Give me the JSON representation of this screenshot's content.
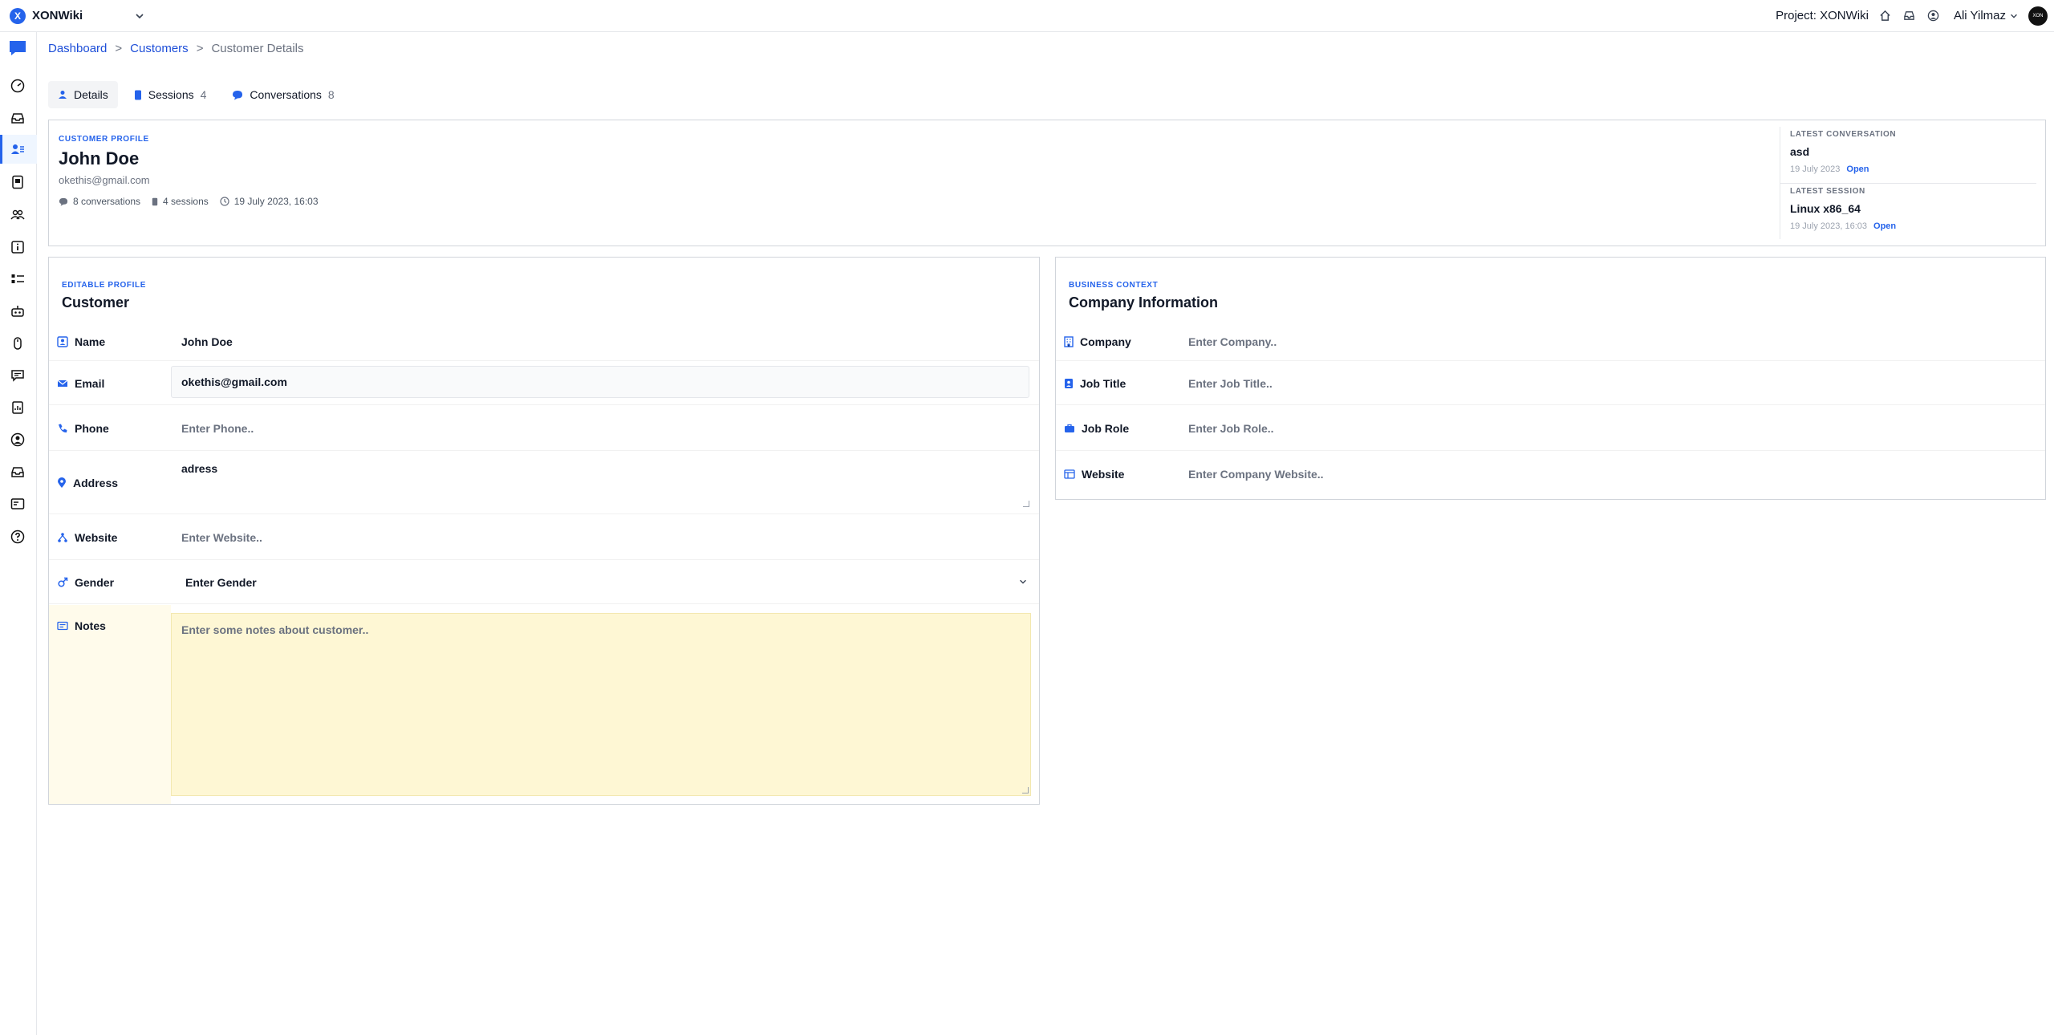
{
  "app": {
    "name": "XONWiki",
    "logo_letter": "X",
    "project_label": "Project: XONWiki",
    "user_name": "Ali Yilmaz",
    "avatar_text": "XON"
  },
  "breadcrumb": {
    "items": [
      "Dashboard",
      "Customers"
    ],
    "separator": ">",
    "current": "Customer Details"
  },
  "tabs": [
    {
      "label": "Details",
      "count": "",
      "active": true
    },
    {
      "label": "Sessions",
      "count": "4",
      "active": false
    },
    {
      "label": "Conversations",
      "count": "8",
      "active": false
    }
  ],
  "profile": {
    "kicker": "CUSTOMER PROFILE",
    "name": "John Doe",
    "email": "okethis@gmail.com",
    "conversations": "8 conversations",
    "sessions": "4 sessions",
    "date": "19 July 2023, 16:03"
  },
  "latest_conversation": {
    "kicker": "LATEST CONVERSATION",
    "title": "asd",
    "date": "19 July 2023",
    "open": "Open"
  },
  "latest_session": {
    "kicker": "LATEST SESSION",
    "title": "Linux x86_64",
    "date": "19 July 2023, 16:03",
    "open": "Open"
  },
  "editable": {
    "kicker": "EDITABLE PROFILE",
    "title": "Customer",
    "name_label": "Name",
    "name_value": "John Doe",
    "email_label": "Email",
    "email_value": "okethis@gmail.com",
    "phone_label": "Phone",
    "phone_placeholder": "Enter Phone..",
    "address_label": "Address",
    "address_value": "adress",
    "website_label": "Website",
    "website_placeholder": "Enter Website..",
    "gender_label": "Gender",
    "gender_value": "Enter Gender",
    "notes_label": "Notes",
    "notes_placeholder": "Enter some notes about customer.."
  },
  "business": {
    "kicker": "BUSINESS CONTEXT",
    "title": "Company Information",
    "company_label": "Company",
    "company_placeholder": "Enter Company..",
    "job_title_label": "Job Title",
    "job_title_placeholder": "Enter Job Title..",
    "job_role_label": "Job Role",
    "job_role_placeholder": "Enter Job Role..",
    "website_label": "Website",
    "website_placeholder": "Enter Company Website.."
  },
  "colors": {
    "accent": "#2563eb",
    "notes_bg": "#fef7d4"
  }
}
